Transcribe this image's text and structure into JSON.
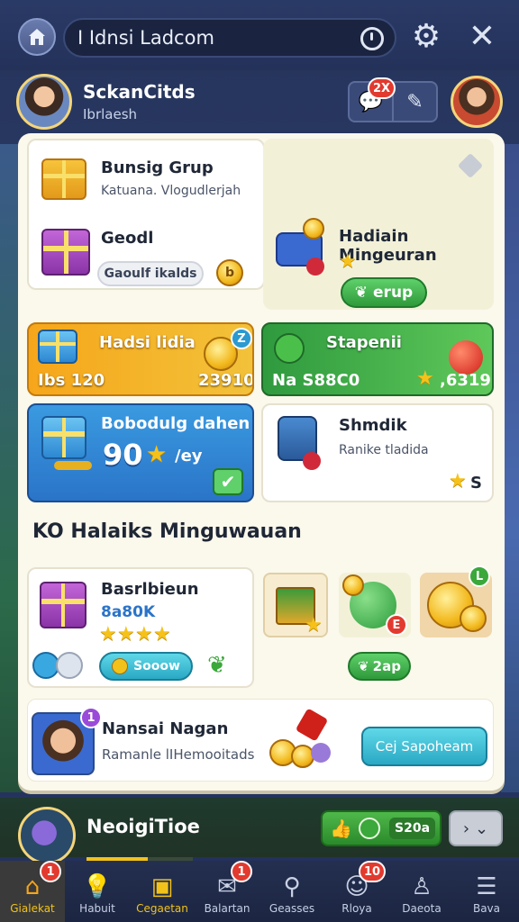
{
  "topbar": {
    "search_value": "I Idnsi Ladcom"
  },
  "profile": {
    "name": "SckanCitds",
    "subtitle": "Ibrlaesh",
    "badge_count": "2X"
  },
  "cards": {
    "bonus_group": {
      "title": "Bunsig Grup",
      "subtitle": "Katuana. Vlogudlerjah"
    },
    "geodi": {
      "title": "Geodl",
      "button_label": "Gaoulf ikalds",
      "coin_label": "b"
    },
    "weekly_gift": {
      "title": "Hadiain Mingeuran",
      "button_label": "erup"
    },
    "orange": {
      "title": "Hadsi lidia",
      "value_left": "Ibs 120",
      "value_right": "23910",
      "badge": "Z"
    },
    "green": {
      "title": "Stapenii",
      "value_left": "Na S88C0",
      "value_right": ",6319"
    },
    "blue": {
      "title": "Bobodulg dahen",
      "value": "90",
      "unit": "/ey"
    },
    "shmdik": {
      "title": "Shmdik",
      "subtitle": "Ranike tladida",
      "stars": "S"
    }
  },
  "section": {
    "title": "KO Halaiks Minguwauan"
  },
  "weekly_row": {
    "title": "Basrlbieun",
    "amount": "8a80K",
    "button_label": "Sooow",
    "rewards_button": "2ap",
    "rewards_badge": "E",
    "coin_pile_badge": "L"
  },
  "friend": {
    "name": "Nansai Nagan",
    "subtitle": "Ramanle lIHemooitads",
    "badge": "1",
    "action_label": "Cej Sapoheam"
  },
  "player_bar": {
    "name": "NeoigiTioe",
    "currency": "S20a",
    "progress": 0.58
  },
  "nav": [
    {
      "label": "Gialekat",
      "icon": "home-icon",
      "badge": "1"
    },
    {
      "label": "Habuit",
      "icon": "bulb-icon",
      "badge": ""
    },
    {
      "label": "Cegaetan",
      "icon": "shop-icon",
      "badge": ""
    },
    {
      "label": "Balartan",
      "icon": "mail-icon",
      "badge": "1"
    },
    {
      "label": "Geasses",
      "icon": "search-icon",
      "badge": ""
    },
    {
      "label": "Rloya",
      "icon": "friends-icon",
      "badge": "10"
    },
    {
      "label": "Daeota",
      "icon": "profile-icon",
      "badge": ""
    },
    {
      "label": "Bava",
      "icon": "menu-icon",
      "badge": ""
    }
  ]
}
